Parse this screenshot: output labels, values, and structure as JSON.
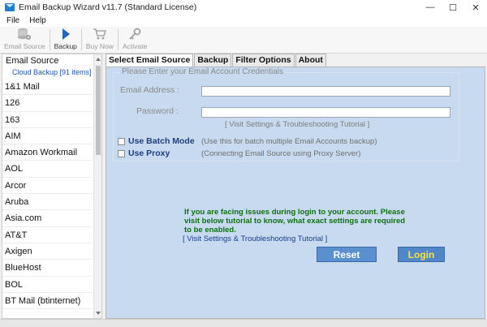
{
  "window": {
    "title": "Email Backup Wizard v11.7 (Standard License)",
    "minimize": "—",
    "maximize": "☐",
    "close": "✕"
  },
  "menu": [
    "File",
    "Help"
  ],
  "toolbar": {
    "email_source": "Email Source",
    "backup": "Backup",
    "buy_now": "Buy Now",
    "activate": "Activate"
  },
  "sidebar": {
    "header": "Email Source",
    "subheader": "Cloud Backup [91 items]",
    "items": [
      "1&1 Mail",
      "126",
      "163",
      "AIM",
      "Amazon Workmail",
      "AOL",
      "Arcor",
      "Aruba",
      "Asia.com",
      "AT&T",
      "Axigen",
      "BlueHost",
      "BOL",
      "BT Mail (btinternet)"
    ]
  },
  "tabs": [
    "Select Email Source",
    "Backup",
    "Filter Options",
    "About"
  ],
  "credentials": {
    "legend": "Please Enter your Email Account Credentials",
    "email_label": "Email Address :",
    "email_value": "",
    "password_label": "Password :",
    "password_value": "",
    "tutorial_link": "[ Visit Settings & Troubleshooting Tutorial ]",
    "batch_label": "Use Batch Mode",
    "batch_hint": "(Use this for batch multiple Email Accounts backup)",
    "proxy_label": "Use Proxy",
    "proxy_hint": "(Connecting Email Source using Proxy Server)"
  },
  "notice": {
    "text": "If you are facing issues during login to your account. Please visit below tutorial to know, what exact settings are required to be enabled.",
    "link": "[ Visit Settings & Troubleshooting Tutorial ]"
  },
  "buttons": {
    "reset": "Reset",
    "login": "Login"
  },
  "colors": {
    "panel_bg": "#c7daef",
    "notice_green": "#107010",
    "login_text": "#ffe33a",
    "button_blue": "#5a8fd0"
  }
}
